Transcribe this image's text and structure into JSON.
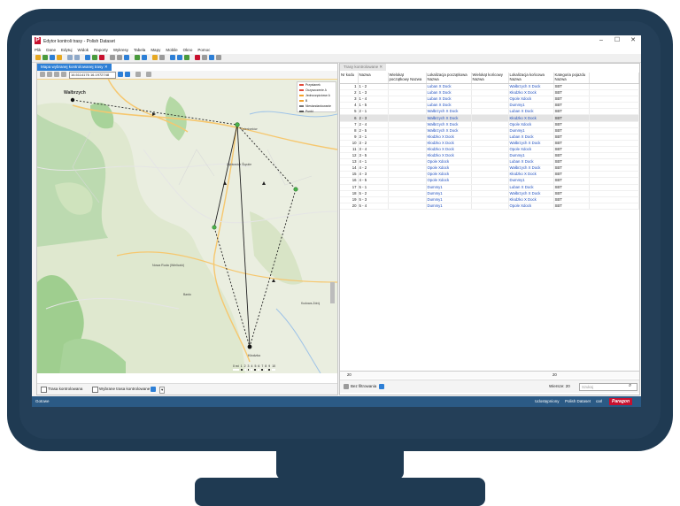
{
  "app": {
    "title": "Edytor kontroli trasy - Polish Dataset",
    "logo_letter": "P"
  },
  "window_buttons": {
    "minimize": "–",
    "maximize": "☐",
    "close": "✕"
  },
  "menu": [
    "Plik",
    "Dane",
    "Edytuj",
    "Widok",
    "Raporty",
    "Wykresy",
    "Tabela",
    "Mapy",
    "Mobile",
    "Okno",
    "Pomoc"
  ],
  "left_panel": {
    "tab_label": "Mapa wybranej kontrolowanej trasy",
    "tab_close": "✕",
    "coordinates": "16.5114176 16.1972748"
  },
  "map": {
    "places": {
      "walbrzych": "Wałbrzych",
      "nowa_ruda": "Nowa Ruda (Wieliczki)",
      "klodzko": "Kłodzko",
      "kudowa": "Kudowa-Zdrój",
      "dzierzoniow": "Dzierżoniów",
      "bardo": "Bardo",
      "walbrzych2": "Ząbkowice Śląskie"
    },
    "legend": [
      "Przystanek",
      "Oczyszczenie A",
      "Jednoczęściowe A",
      "B",
      "Niestandardowanie",
      "Punkt"
    ],
    "legend_colors": [
      "#e14b3b",
      "#e14b3b",
      "#f3a22c",
      "#f3a22c",
      "#777777",
      "#555555"
    ],
    "scale": [
      "0 mi",
      "1",
      "2",
      "3",
      "4",
      "5",
      "6",
      "7",
      "8",
      "9",
      "10"
    ]
  },
  "left_bottom": {
    "checkbox1": "Trasa kontrolowana",
    "checkbox2": "Wybrane trasa kontrolowane",
    "mini_btn": "▾"
  },
  "right_panel": {
    "tab_label": "Trasy kontrolowane",
    "tab_close": "✕",
    "headers": [
      "Nr kodu",
      "Nazwa",
      "Wielokąt początkowy Nazwa",
      "Lokalizacja początkowa Nazwa",
      "Wielokąt końcowy Nazwa",
      "Lokalizacja końcowa Nazwa",
      "Kategoria pojazdu Nazwa"
    ],
    "rows": [
      {
        "nr": "1",
        "name": "1 - 2",
        "start": "Luban X Dock",
        "end": "Wałbrzych X Dock",
        "cat": "SBT"
      },
      {
        "nr": "2",
        "name": "1 - 3",
        "start": "Luban X Dock",
        "end": "Kłodzko X Dock",
        "cat": "SBT"
      },
      {
        "nr": "3",
        "name": "1 - 4",
        "start": "Luban X Dock",
        "end": "Opole Xdock",
        "cat": "SBT"
      },
      {
        "nr": "4",
        "name": "1 - 5",
        "start": "Luban X Dock",
        "end": "Dummy1",
        "cat": "SBT"
      },
      {
        "nr": "5",
        "name": "2 - 1",
        "start": "Wałbrzych X Dock",
        "end": "Luban X Dock",
        "cat": "SBT"
      },
      {
        "nr": "6",
        "name": "2 - 3",
        "start": "Wałbrzych X Dock",
        "end": "Kłodzko X Dock",
        "cat": "SBT"
      },
      {
        "nr": "7",
        "name": "2 - 4",
        "start": "Wałbrzych X Dock",
        "end": "Opole Xdock",
        "cat": "SBT"
      },
      {
        "nr": "8",
        "name": "2 - 5",
        "start": "Wałbrzych X Dock",
        "end": "Dummy1",
        "cat": "SBT"
      },
      {
        "nr": "9",
        "name": "3 - 1",
        "start": "Kłodzko X Dock",
        "end": "Luban X Dock",
        "cat": "SBT"
      },
      {
        "nr": "10",
        "name": "3 - 2",
        "start": "Kłodzko X Dock",
        "end": "Wałbrzych X Dock",
        "cat": "SBT"
      },
      {
        "nr": "11",
        "name": "3 - 4",
        "start": "Kłodzko X Dock",
        "end": "Opole Xdock",
        "cat": "SBT"
      },
      {
        "nr": "12",
        "name": "3 - 5",
        "start": "Kłodzko X Dock",
        "end": "Dummy1",
        "cat": "SBT"
      },
      {
        "nr": "13",
        "name": "4 - 1",
        "start": "Opole Xdock",
        "end": "Luban X Dock",
        "cat": "SBT"
      },
      {
        "nr": "14",
        "name": "4 - 2",
        "start": "Opole Xdock",
        "end": "Wałbrzych X Dock",
        "cat": "SBT"
      },
      {
        "nr": "15",
        "name": "4 - 3",
        "start": "Opole Xdock",
        "end": "Kłodzko X Dock",
        "cat": "SBT"
      },
      {
        "nr": "16",
        "name": "4 - 5",
        "start": "Opole Xdock",
        "end": "Dummy1",
        "cat": "SBT"
      },
      {
        "nr": "17",
        "name": "5 - 1",
        "start": "Dummy1",
        "end": "Luban X Dock",
        "cat": "SBT"
      },
      {
        "nr": "18",
        "name": "5 - 2",
        "start": "Dummy1",
        "end": "Wałbrzych X Dock",
        "cat": "SBT"
      },
      {
        "nr": "19",
        "name": "5 - 3",
        "start": "Dummy1",
        "end": "Kłodzko X Dock",
        "cat": "SBT"
      },
      {
        "nr": "20",
        "name": "5 - 4",
        "start": "Dummy1",
        "end": "Opole Xdock",
        "cat": "SBT"
      }
    ],
    "selected_row": "6",
    "footer_left": "20",
    "footer_right": "20",
    "filter_label": "Bez filtrowania",
    "records_label": "Wiersze: 20",
    "search_placeholder": "Szukaj",
    "search_icon": "⌕"
  },
  "status": {
    "left": "Gotowe",
    "right1": "Udostępniony",
    "right2": "Polish Dataset",
    "right3": "carl",
    "brand": "Paragon"
  }
}
